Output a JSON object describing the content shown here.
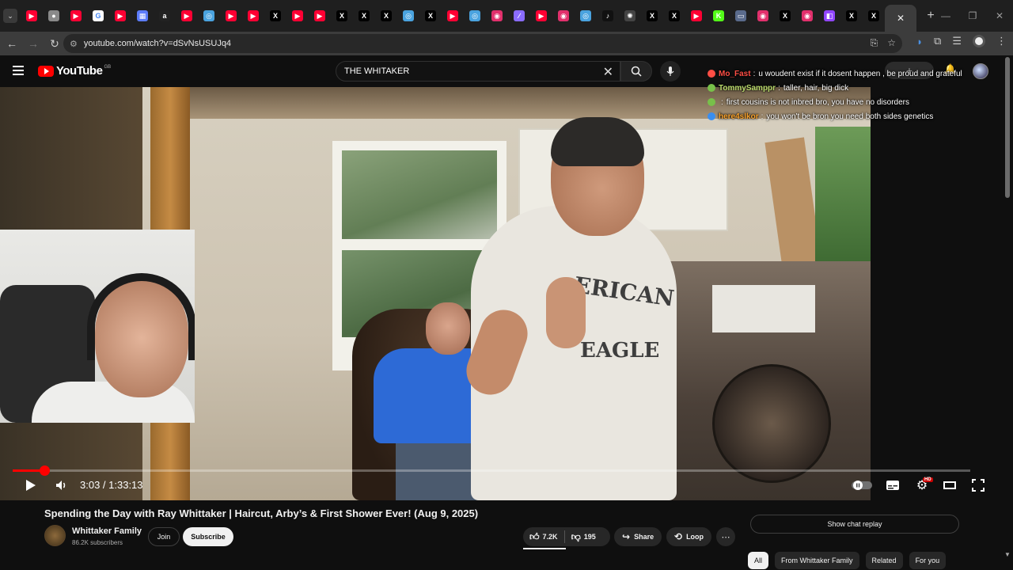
{
  "browser": {
    "tabs": [
      {
        "icon": "youtube-icon",
        "color": "#ff0033",
        "glyph": "▶"
      },
      {
        "icon": "chrome-icon",
        "color": "#8a8a8a",
        "glyph": "●"
      },
      {
        "icon": "youtube-icon",
        "color": "#ff0033",
        "glyph": "▶"
      },
      {
        "icon": "google-icon",
        "color": "#ffffff",
        "glyph": "G"
      },
      {
        "icon": "youtube-icon",
        "color": "#ff0033",
        "glyph": "▶"
      },
      {
        "icon": "docs-icon",
        "color": "#5c7cfa",
        "glyph": "▦"
      },
      {
        "icon": "amazon-icon",
        "color": "#222222",
        "glyph": "a"
      },
      {
        "icon": "youtube-icon",
        "color": "#ff0033",
        "glyph": "▶"
      },
      {
        "icon": "edge-icon",
        "color": "#4aa3df",
        "glyph": "◎"
      },
      {
        "icon": "youtube-icon",
        "color": "#ff0033",
        "glyph": "▶"
      },
      {
        "icon": "youtube-icon",
        "color": "#ff0033",
        "glyph": "▶"
      },
      {
        "icon": "x-icon",
        "color": "#000000",
        "glyph": "X"
      },
      {
        "icon": "youtube-icon",
        "color": "#ff0033",
        "glyph": "▶"
      },
      {
        "icon": "youtube-icon",
        "color": "#ff0033",
        "glyph": "▶"
      },
      {
        "icon": "x-icon",
        "color": "#000000",
        "glyph": "X"
      },
      {
        "icon": "x-icon",
        "color": "#000000",
        "glyph": "X"
      },
      {
        "icon": "x-icon",
        "color": "#000000",
        "glyph": "X"
      },
      {
        "icon": "edge-icon",
        "color": "#4aa3df",
        "glyph": "◎"
      },
      {
        "icon": "x-icon",
        "color": "#000000",
        "glyph": "X"
      },
      {
        "icon": "youtube-icon",
        "color": "#ff0033",
        "glyph": "▶"
      },
      {
        "icon": "edge-icon",
        "color": "#4aa3df",
        "glyph": "◎"
      },
      {
        "icon": "instagram-icon",
        "color": "#e1306c",
        "glyph": "◉"
      },
      {
        "icon": "feather-icon",
        "color": "#8a6cff",
        "glyph": "∕"
      },
      {
        "icon": "youtube-icon",
        "color": "#ff0033",
        "glyph": "▶"
      },
      {
        "icon": "instagram-icon",
        "color": "#e1306c",
        "glyph": "◉"
      },
      {
        "icon": "edge-icon",
        "color": "#4aa3df",
        "glyph": "◎"
      },
      {
        "icon": "tiktok-icon",
        "color": "#111111",
        "glyph": "♪"
      },
      {
        "icon": "openai-icon",
        "color": "#444444",
        "glyph": "✺"
      },
      {
        "icon": "x-icon",
        "color": "#000000",
        "glyph": "X"
      },
      {
        "icon": "x-icon",
        "color": "#000000",
        "glyph": "X"
      },
      {
        "icon": "youtube-icon",
        "color": "#ff0033",
        "glyph": "▶"
      },
      {
        "icon": "kick-icon",
        "color": "#53fc18",
        "glyph": "K"
      },
      {
        "icon": "window-icon",
        "color": "#5a6b8c",
        "glyph": "▭"
      },
      {
        "icon": "instagram-icon",
        "color": "#e1306c",
        "glyph": "◉"
      },
      {
        "icon": "x-icon",
        "color": "#000000",
        "glyph": "X"
      },
      {
        "icon": "instagram-icon",
        "color": "#e1306c",
        "glyph": "◉"
      },
      {
        "icon": "twitch-icon",
        "color": "#9146ff",
        "glyph": "◧"
      },
      {
        "icon": "x-icon",
        "color": "#000000",
        "glyph": "X"
      },
      {
        "icon": "x-icon",
        "color": "#000000",
        "glyph": "X"
      }
    ],
    "url": "youtube.com/watch?v=dSvNsUSUJq4"
  },
  "masthead": {
    "logo_text": "YouTube",
    "country_code": "GB",
    "search_query": "THE WHITAKER"
  },
  "live_chat": [
    {
      "author": "Mo_Fast",
      "author_color": "#ff4e45",
      "badge_color": "#ff4e45",
      "message": "u woudent exist if it dosent happen , be proud and grateful"
    },
    {
      "author": "TommySamppr",
      "author_color": "#b8d96b",
      "badge_color": "#78c04a",
      "message": "taller, hair, big dick"
    },
    {
      "author": "",
      "author_color": "#ff4e45",
      "badge_color": "#78c04a",
      "message": "first cousins is not inbred bro, you have no disorders"
    },
    {
      "author": "here4slkor",
      "author_color": "#f7a02a",
      "badge_color": "#3a8ef0",
      "message": "you won't be bron you need both sides genetics"
    }
  ],
  "player": {
    "time_display": "3:03 / 1:33:13",
    "progress_fraction": 0.033,
    "quality_badge": "HD"
  },
  "video": {
    "title": "Spending the Day with Ray Whittaker | Haircut, Arby’s & First Shower Ever! (Aug 9, 2025)",
    "shirt_print_top": "ERICAN",
    "shirt_print_bottom": "EAGLE",
    "channel_name": "Whittaker Family",
    "subscribers": "86.2K subscribers",
    "join_label": "Join",
    "subscribe_label": "Subscribe",
    "likes": "7.2K",
    "dislikes": "195",
    "share_label": "Share",
    "loop_label": "Loop",
    "more_label": "⋯"
  },
  "sidebar": {
    "chat_replay_label": "Show chat replay",
    "chips": [
      "All",
      "From Whittaker Family",
      "Related",
      "For you"
    ]
  }
}
